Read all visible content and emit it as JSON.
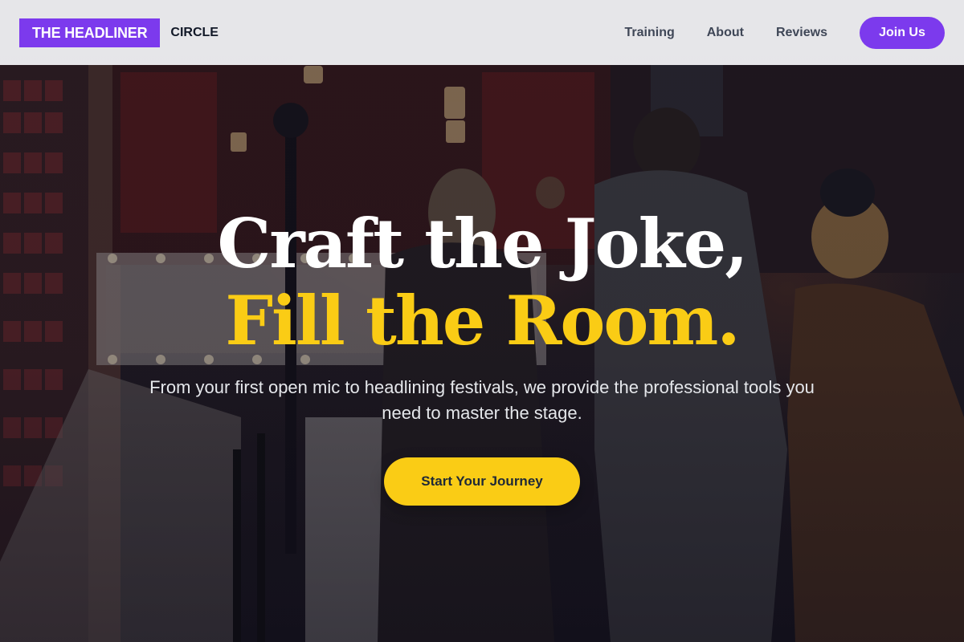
{
  "colors": {
    "accent": "#7c3aed",
    "highlight": "#facc15",
    "nav_bg": "#ececf0",
    "nav_text": "#3f4757"
  },
  "brand": {
    "name": "THE HEADLINER",
    "sub": "CIRCLE"
  },
  "nav": {
    "links": [
      "Training",
      "About",
      "Reviews"
    ],
    "cta_label": "Join Us"
  },
  "hero": {
    "headline_line1": "Craft the Joke,",
    "headline_line2": "Fill the Room.",
    "subtext": "From your first open mic to headlining festivals, we provide the professional tools you need to master the stage.",
    "cta_label": "Start Your Journey",
    "background_image": "comedy club stairwell photo"
  }
}
